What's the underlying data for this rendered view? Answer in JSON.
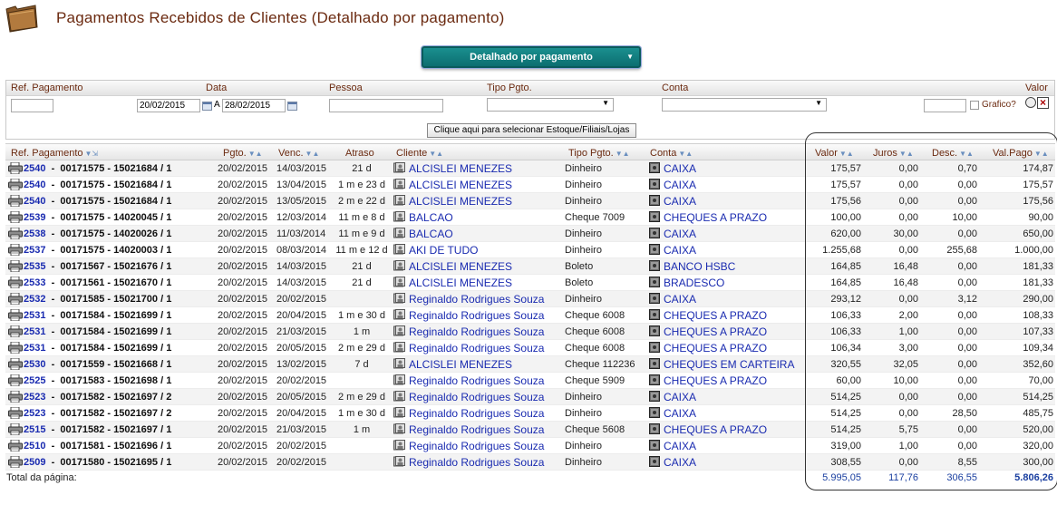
{
  "page": {
    "title": "Pagamentos Recebidos de Clientes (Detalhado por pagamento)"
  },
  "mode_select": {
    "value": "Detalhado por pagamento"
  },
  "filters": {
    "labels": {
      "ref": "Ref. Pagamento",
      "data": "Data",
      "pessoa": "Pessoa",
      "tipo": "Tipo Pgto.",
      "conta": "Conta",
      "valor": "Valor"
    },
    "ref_value": "",
    "date_from": "20/02/2015",
    "date_sep": "A",
    "date_to": "28/02/2015",
    "pessoa_value": "",
    "tipo_value": "",
    "conta_value": "",
    "valor_value": "",
    "grafico_label": "Grafico?",
    "store_button": "Clique aqui para selecionar Estoque/Filiais/Lojas"
  },
  "columns": {
    "ref": "Ref. Pagamento",
    "pgto": "Pgto.",
    "venc": "Venc.",
    "atraso": "Atraso",
    "cliente": "Cliente",
    "tipo": "Tipo Pgto.",
    "conta": "Conta",
    "valor": "Valor",
    "juros": "Juros",
    "desc": "Desc.",
    "valpago": "Val.Pago"
  },
  "rows": [
    {
      "id": "2540",
      "doc": "00171575 - 15021684 / 1",
      "pgto": "20/02/2015",
      "venc": "14/03/2015",
      "atraso": "21 d",
      "cliente": "ALCISLEI MENEZES",
      "tipo": "Dinheiro",
      "conta": "CAIXA",
      "valor": "175,57",
      "juros": "0,00",
      "desc": "0,70",
      "valpago": "174,87"
    },
    {
      "id": "2540",
      "doc": "00171575 - 15021684 / 1",
      "pgto": "20/02/2015",
      "venc": "13/04/2015",
      "atraso": "1 m e 23 d",
      "cliente": "ALCISLEI MENEZES",
      "tipo": "Dinheiro",
      "conta": "CAIXA",
      "valor": "175,57",
      "juros": "0,00",
      "desc": "0,00",
      "valpago": "175,57"
    },
    {
      "id": "2540",
      "doc": "00171575 - 15021684 / 1",
      "pgto": "20/02/2015",
      "venc": "13/05/2015",
      "atraso": "2 m e 22 d",
      "cliente": "ALCISLEI MENEZES",
      "tipo": "Dinheiro",
      "conta": "CAIXA",
      "valor": "175,56",
      "juros": "0,00",
      "desc": "0,00",
      "valpago": "175,56"
    },
    {
      "id": "2539",
      "doc": "00171575 - 14020045 / 1",
      "pgto": "20/02/2015",
      "venc": "12/03/2014",
      "atraso": "11 m e 8 d",
      "cliente": "BALCAO",
      "tipo": "Cheque 7009",
      "conta": "CHEQUES A PRAZO",
      "valor": "100,00",
      "juros": "0,00",
      "desc": "10,00",
      "valpago": "90,00"
    },
    {
      "id": "2538",
      "doc": "00171575 - 14020026 / 1",
      "pgto": "20/02/2015",
      "venc": "11/03/2014",
      "atraso": "11 m e 9 d",
      "cliente": "BALCAO",
      "tipo": "Dinheiro",
      "conta": "CAIXA",
      "valor": "620,00",
      "juros": "30,00",
      "desc": "0,00",
      "valpago": "650,00"
    },
    {
      "id": "2537",
      "doc": "00171575 - 14020003 / 1",
      "pgto": "20/02/2015",
      "venc": "08/03/2014",
      "atraso": "11 m e 12 d",
      "cliente": "AKI DE TUDO",
      "tipo": "Dinheiro",
      "conta": "CAIXA",
      "valor": "1.255,68",
      "juros": "0,00",
      "desc": "255,68",
      "valpago": "1.000,00"
    },
    {
      "id": "2535",
      "doc": "00171567 - 15021676 / 1",
      "pgto": "20/02/2015",
      "venc": "14/03/2015",
      "atraso": "21 d",
      "cliente": "ALCISLEI MENEZES",
      "tipo": "Boleto",
      "conta": "BANCO HSBC",
      "valor": "164,85",
      "juros": "16,48",
      "desc": "0,00",
      "valpago": "181,33"
    },
    {
      "id": "2533",
      "doc": "00171561 - 15021670 / 1",
      "pgto": "20/02/2015",
      "venc": "14/03/2015",
      "atraso": "21 d",
      "cliente": "ALCISLEI MENEZES",
      "tipo": "Boleto",
      "conta": "BRADESCO",
      "valor": "164,85",
      "juros": "16,48",
      "desc": "0,00",
      "valpago": "181,33"
    },
    {
      "id": "2532",
      "doc": "00171585 - 15021700 / 1",
      "pgto": "20/02/2015",
      "venc": "20/02/2015",
      "atraso": "",
      "cliente": "Reginaldo Rodrigues Souza",
      "tipo": "Dinheiro",
      "conta": "CAIXA",
      "valor": "293,12",
      "juros": "0,00",
      "desc": "3,12",
      "valpago": "290,00"
    },
    {
      "id": "2531",
      "doc": "00171584 - 15021699 / 1",
      "pgto": "20/02/2015",
      "venc": "20/04/2015",
      "atraso": "1 m e 30 d",
      "cliente": "Reginaldo Rodrigues Souza",
      "tipo": "Cheque 6008",
      "conta": "CHEQUES A PRAZO",
      "valor": "106,33",
      "juros": "2,00",
      "desc": "0,00",
      "valpago": "108,33"
    },
    {
      "id": "2531",
      "doc": "00171584 - 15021699 / 1",
      "pgto": "20/02/2015",
      "venc": "21/03/2015",
      "atraso": "1 m",
      "cliente": "Reginaldo Rodrigues Souza",
      "tipo": "Cheque 6008",
      "conta": "CHEQUES A PRAZO",
      "valor": "106,33",
      "juros": "1,00",
      "desc": "0,00",
      "valpago": "107,33"
    },
    {
      "id": "2531",
      "doc": "00171584 - 15021699 / 1",
      "pgto": "20/02/2015",
      "venc": "20/05/2015",
      "atraso": "2 m e 29 d",
      "cliente": "Reginaldo Rodrigues Souza",
      "tipo": "Cheque 6008",
      "conta": "CHEQUES A PRAZO",
      "valor": "106,34",
      "juros": "3,00",
      "desc": "0,00",
      "valpago": "109,34"
    },
    {
      "id": "2530",
      "doc": "00171559 - 15021668 / 1",
      "pgto": "20/02/2015",
      "venc": "13/02/2015",
      "atraso": "7 d",
      "cliente": "ALCISLEI MENEZES",
      "tipo": "Cheque 112236",
      "conta": "CHEQUES EM CARTEIRA",
      "valor": "320,55",
      "juros": "32,05",
      "desc": "0,00",
      "valpago": "352,60"
    },
    {
      "id": "2525",
      "doc": "00171583 - 15021698 / 1",
      "pgto": "20/02/2015",
      "venc": "20/02/2015",
      "atraso": "",
      "cliente": "Reginaldo Rodrigues Souza",
      "tipo": "Cheque 5909",
      "conta": "CHEQUES A PRAZO",
      "valor": "60,00",
      "juros": "10,00",
      "desc": "0,00",
      "valpago": "70,00"
    },
    {
      "id": "2523",
      "doc": "00171582 - 15021697 / 2",
      "pgto": "20/02/2015",
      "venc": "20/05/2015",
      "atraso": "2 m e 29 d",
      "cliente": "Reginaldo Rodrigues Souza",
      "tipo": "Dinheiro",
      "conta": "CAIXA",
      "valor": "514,25",
      "juros": "0,00",
      "desc": "0,00",
      "valpago": "514,25"
    },
    {
      "id": "2523",
      "doc": "00171582 - 15021697 / 2",
      "pgto": "20/02/2015",
      "venc": "20/04/2015",
      "atraso": "1 m e 30 d",
      "cliente": "Reginaldo Rodrigues Souza",
      "tipo": "Dinheiro",
      "conta": "CAIXA",
      "valor": "514,25",
      "juros": "0,00",
      "desc": "28,50",
      "valpago": "485,75"
    },
    {
      "id": "2515",
      "doc": "00171582 - 15021697 / 1",
      "pgto": "20/02/2015",
      "venc": "21/03/2015",
      "atraso": "1 m",
      "cliente": "Reginaldo Rodrigues Souza",
      "tipo": "Cheque 5608",
      "conta": "CHEQUES A PRAZO",
      "valor": "514,25",
      "juros": "5,75",
      "desc": "0,00",
      "valpago": "520,00"
    },
    {
      "id": "2510",
      "doc": "00171581 - 15021696 / 1",
      "pgto": "20/02/2015",
      "venc": "20/02/2015",
      "atraso": "",
      "cliente": "Reginaldo Rodrigues Souza",
      "tipo": "Dinheiro",
      "conta": "CAIXA",
      "valor": "319,00",
      "juros": "1,00",
      "desc": "0,00",
      "valpago": "320,00"
    },
    {
      "id": "2509",
      "doc": "00171580 - 15021695 / 1",
      "pgto": "20/02/2015",
      "venc": "20/02/2015",
      "atraso": "",
      "cliente": "Reginaldo Rodrigues Souza",
      "tipo": "Dinheiro",
      "conta": "CAIXA",
      "valor": "308,55",
      "juros": "0,00",
      "desc": "8,55",
      "valpago": "300,00"
    }
  ],
  "totals": {
    "label": "Total da página:",
    "valor": "5.995,05",
    "juros": "117,76",
    "desc": "306,55",
    "valpago": "5.806,26"
  }
}
